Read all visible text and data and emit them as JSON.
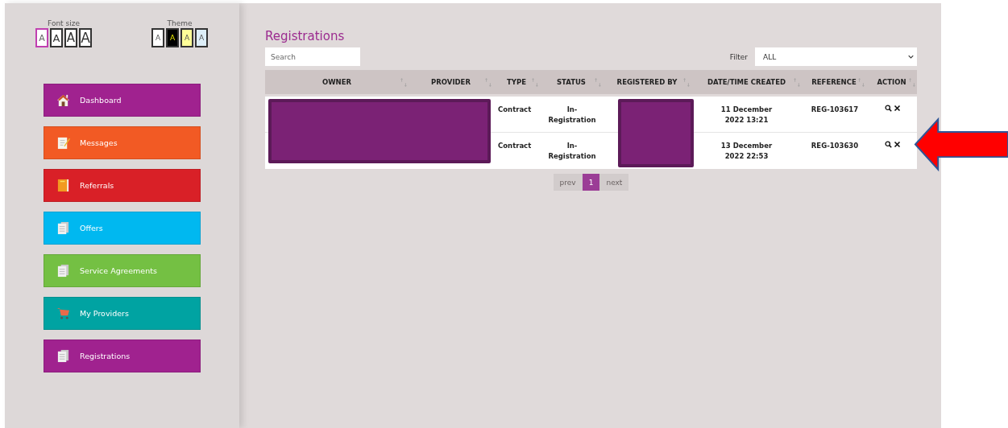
{
  "font_size": {
    "label": "Font size",
    "options": [
      {
        "label": "A",
        "selected": true
      },
      {
        "label": "A",
        "selected": false
      },
      {
        "label": "A",
        "selected": false
      },
      {
        "label": "A",
        "selected": false
      }
    ]
  },
  "theme": {
    "label": "Theme",
    "options": [
      {
        "label": "A",
        "color": "#ffffff"
      },
      {
        "label": "A",
        "color": "#000000"
      },
      {
        "label": "A",
        "color": "#ffff99"
      },
      {
        "label": "A",
        "color": "#ddeef8"
      }
    ]
  },
  "sidebar": {
    "items": [
      {
        "label": "Dashboard",
        "kind": "home",
        "color": "#a0228f"
      },
      {
        "label": "Messages",
        "kind": "note",
        "color": "#f25a24"
      },
      {
        "label": "Referrals",
        "kind": "book",
        "color": "#d92027"
      },
      {
        "label": "Offers",
        "kind": "docs",
        "color": "#00b8f0"
      },
      {
        "label": "Service Agreements",
        "kind": "docs",
        "color": "#74c043"
      },
      {
        "label": "My Providers",
        "kind": "cart",
        "color": "#00a3a2"
      },
      {
        "label": "Registrations",
        "kind": "docs",
        "color": "#a0228f"
      }
    ]
  },
  "page": {
    "title": "Registrations"
  },
  "search": {
    "placeholder": "Search"
  },
  "filter": {
    "label": "Filter",
    "value": "ALL"
  },
  "table": {
    "columns": [
      "OWNER",
      "PROVIDER",
      "TYPE",
      "STATUS",
      "REGISTERED BY",
      "DATE/TIME CREATED",
      "REFERENCE",
      "ACTION"
    ],
    "rows": [
      {
        "type": "Contract",
        "status": "In-Registration",
        "created": "11 December 2022 13:21",
        "reference": "REG-103617"
      },
      {
        "type": "Contract",
        "status": "In-Registration",
        "created": "13 December 2022 22:53",
        "reference": "REG-103630"
      }
    ]
  },
  "pagination": {
    "prev": "prev",
    "pages": [
      {
        "label": "1",
        "selected": true
      }
    ],
    "next": "next"
  }
}
